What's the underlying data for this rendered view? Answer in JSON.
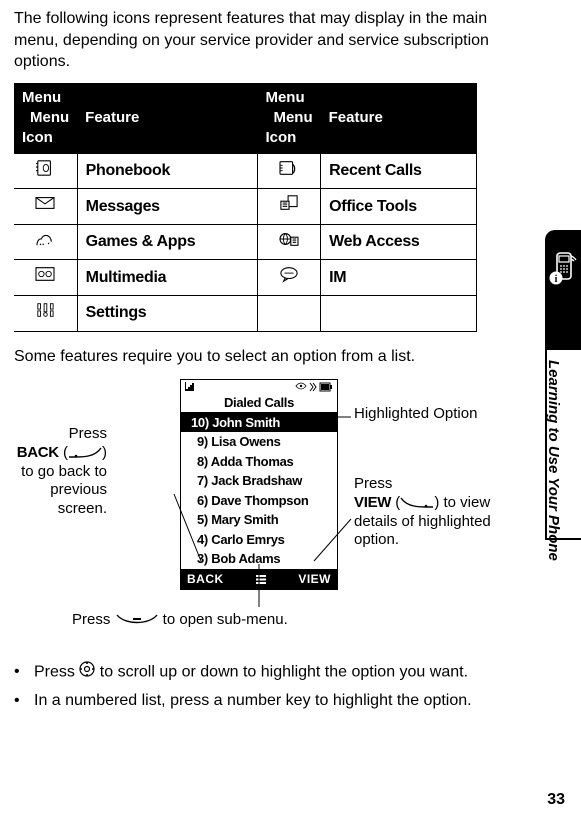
{
  "intro": "The following icons represent features that may display in the main menu, depending on your service provider and service subscription options.",
  "table": {
    "head": {
      "c1": "Menu Icon",
      "c2": "Feature",
      "c3": "Menu Icon",
      "c4": "Feature"
    },
    "rows": [
      {
        "f1": "Phonebook",
        "f2": "Recent Calls"
      },
      {
        "f1": "Messages",
        "f2": "Office Tools"
      },
      {
        "f1": "Games & Apps",
        "f2": "Web Access"
      },
      {
        "f1": "Multimedia",
        "f2": "IM"
      },
      {
        "f1": "Settings",
        "f2": ""
      }
    ]
  },
  "some": "Some features require you to select an option from a list.",
  "screen": {
    "title": "Dialed Calls",
    "items": [
      "10) John Smith",
      "9) Lisa Owens",
      "8) Adda Thomas",
      "7) Jack Bradshaw",
      "6) Dave Thompson",
      "5) Mary Smith",
      "4) Carlo Emrys",
      "3) Bob Adams"
    ],
    "soft_left": "BACK",
    "soft_right": "VIEW"
  },
  "ann": {
    "hl": "Highlighted Option",
    "view1": "Press",
    "view_key": "VIEW",
    "view2": " to view details of highlighted option.",
    "back1": "Press",
    "back_key": "BACK",
    "back2": " to go back to previous screen.",
    "sub": "Press ",
    "sub2": " to open sub-menu."
  },
  "bullets": [
    {
      "pre": "Press ",
      "post": " to scroll up or down to highlight the option you want."
    },
    {
      "pre": "In a numbered list, press a number key to highlight the option.",
      "post": ""
    }
  ],
  "side_label": "Learning to Use Your Phone",
  "page_num": "33"
}
